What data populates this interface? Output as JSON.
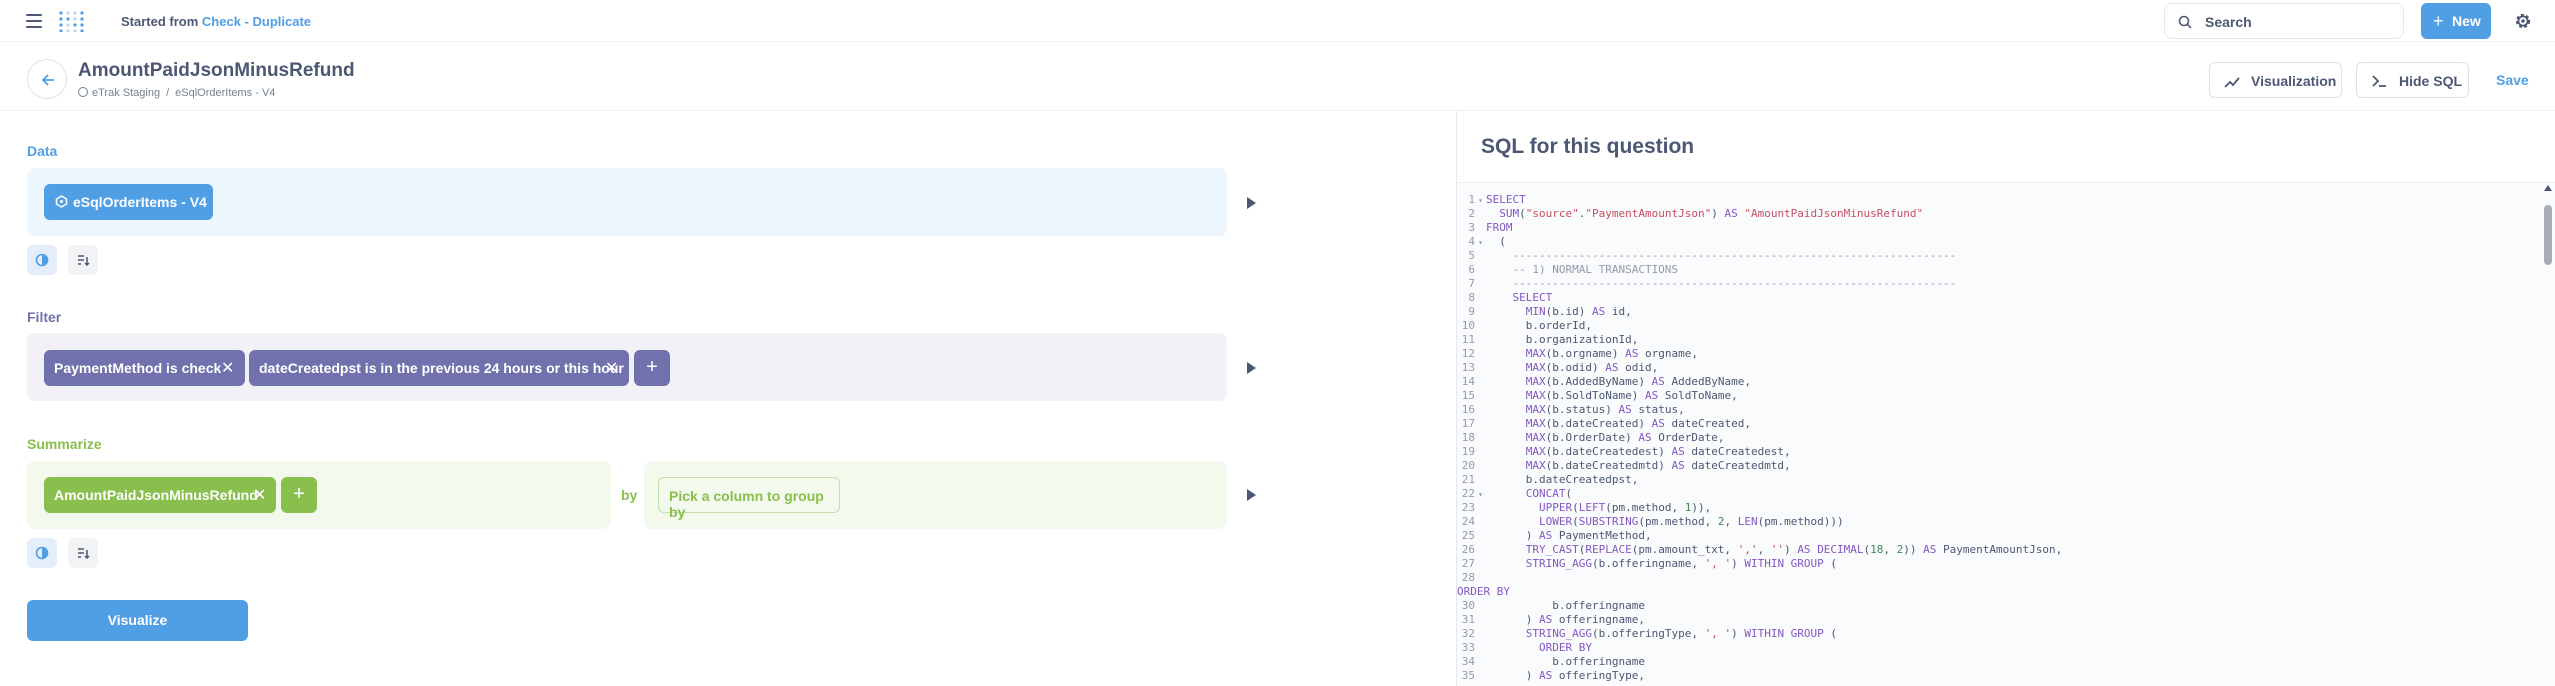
{
  "nav": {
    "started_prefix": "Started from",
    "started_link": "Check - Duplicate",
    "search_placeholder": "Search",
    "new_label": "New"
  },
  "header": {
    "title": "AmountPaidJsonMinusRefund",
    "breadcrumb_db": "eTrak Staging",
    "breadcrumb_table": "eSqlOrderItems - V4",
    "visualization_label": "Visualization",
    "hide_sql_label": "Hide SQL",
    "save_label": "Save"
  },
  "notebook": {
    "data_label": "Data",
    "data_source": "eSqlOrderItems - V4",
    "filter_label": "Filter",
    "filters": [
      "PaymentMethod is check",
      "dateCreatedpst is in the previous 24 hours or this hour"
    ],
    "summarize_label": "Summarize",
    "metric": "AmountPaidJsonMinusRefund",
    "by_label": "by",
    "group_placeholder": "Pick a column to group by",
    "visualize_label": "Visualize"
  },
  "sql_panel": {
    "title": "SQL for this question",
    "lines": [
      {
        "n": "1",
        "fold": true,
        "text": "SELECT"
      },
      {
        "n": "2",
        "text": "  SUM(\"source\".\"PaymentAmountJson\") AS \"AmountPaidJsonMinusRefund\""
      },
      {
        "n": "3",
        "text": "FROM"
      },
      {
        "n": "4",
        "fold": true,
        "text": "  ("
      },
      {
        "n": "5",
        "text": "    -------------------------------------------------------------------"
      },
      {
        "n": "6",
        "text": "    -- 1) NORMAL TRANSACTIONS"
      },
      {
        "n": "7",
        "text": "    -------------------------------------------------------------------"
      },
      {
        "n": "8",
        "text": "    SELECT"
      },
      {
        "n": "9",
        "text": "      MIN(b.id) AS id,"
      },
      {
        "n": "10",
        "text": "      b.orderId,"
      },
      {
        "n": "11",
        "text": "      b.organizationId,"
      },
      {
        "n": "12",
        "text": "      MAX(b.orgname) AS orgname,"
      },
      {
        "n": "13",
        "text": "      MAX(b.odid) AS odid,"
      },
      {
        "n": "14",
        "text": "      MAX(b.AddedByName) AS AddedByName,"
      },
      {
        "n": "15",
        "text": "      MAX(b.SoldToName) AS SoldToName,"
      },
      {
        "n": "16",
        "text": "      MAX(b.status) AS status,"
      },
      {
        "n": "17",
        "text": "      MAX(b.dateCreated) AS dateCreated,"
      },
      {
        "n": "18",
        "text": "      MAX(b.OrderDate) AS OrderDate,"
      },
      {
        "n": "19",
        "text": "      MAX(b.dateCreatedest) AS dateCreatedest,"
      },
      {
        "n": "20",
        "text": "      MAX(b.dateCreatedmtd) AS dateCreatedmtd,"
      },
      {
        "n": "21",
        "text": "      b.dateCreatedpst,"
      },
      {
        "n": "22",
        "fold": true,
        "text": "      CONCAT("
      },
      {
        "n": "23",
        "text": "        UPPER(LEFT(pm.method, 1)),"
      },
      {
        "n": "24",
        "text": "        LOWER(SUBSTRING(pm.method, 2, LEN(pm.method)))"
      },
      {
        "n": "25",
        "text": "      ) AS PaymentMethod,"
      },
      {
        "n": "26",
        "text": "      TRY_CAST(REPLACE(pm.amount_txt, ',', '') AS DECIMAL(18, 2)) AS PaymentAmountJson,"
      },
      {
        "n": "27",
        "text": "      STRING_AGG(b.offeringname, ', ') WITHIN GROUP ("
      },
      {
        "n": "28",
        "text": ""
      },
      {
        "n": "",
        "text": "ORDER BY"
      },
      {
        "n": "30",
        "text": "          b.offeringname"
      },
      {
        "n": "31",
        "text": "      ) AS offeringname,"
      },
      {
        "n": "32",
        "text": "      STRING_AGG(b.offeringType, ', ') WITHIN GROUP ("
      },
      {
        "n": "33",
        "text": "        ORDER BY"
      },
      {
        "n": "34",
        "text": "          b.offeringname"
      },
      {
        "n": "35",
        "text": "      ) AS offeringType,"
      }
    ]
  },
  "colors": {
    "brand": "#509ee3",
    "filter": "#7172ad",
    "summarize": "#88bf4d",
    "text": "#4c5773"
  }
}
